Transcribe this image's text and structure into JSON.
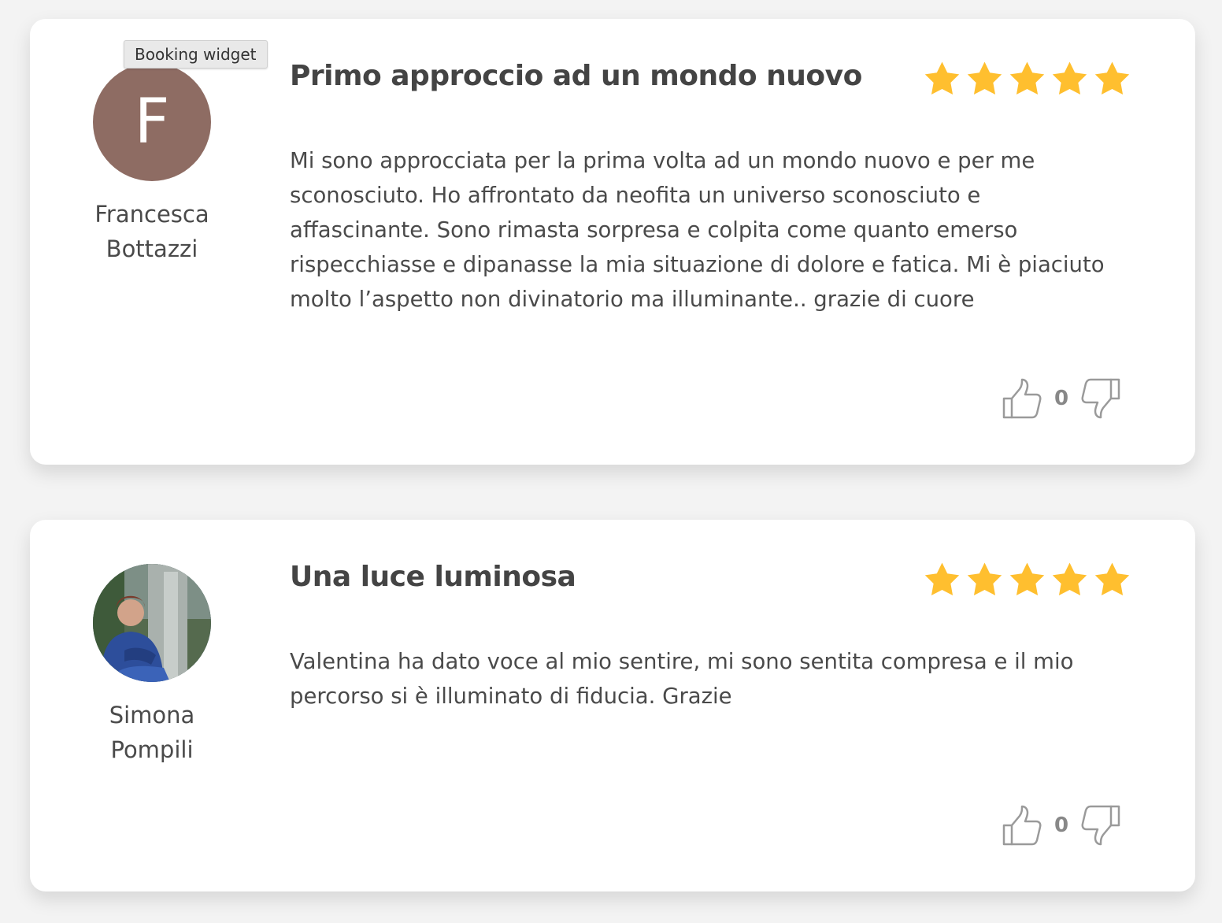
{
  "tooltip": {
    "text": "Booking widget"
  },
  "colors": {
    "star": "#ffbf2f",
    "avatar_bg": "#8e6c63",
    "vote_icon": "#9a9a9a"
  },
  "reviews": [
    {
      "author_initial": "F",
      "author_first": "Francesca",
      "author_last": "Bottazzi",
      "avatar_type": "letter",
      "title": "Primo approccio ad un mondo nuovo",
      "rating": 5,
      "body": "Mi sono approcciata per la prima volta ad un mondo nuovo e per me sconosciuto. Ho affrontato da neofita un universo sconosciuto e affascinante. Sono rimasta sorpresa e colpita come quanto emerso rispecchiasse e dipanasse la mia situazione di dolore e fatica. Mi è piaciuto molto l’aspetto non divinatorio ma illuminante.. grazie di cuore",
      "votes": "0",
      "icons": {
        "like": "thumbs-up-icon",
        "dislike": "thumbs-down-icon",
        "star": "star-icon"
      }
    },
    {
      "author_first": "Simona",
      "author_last": "Pompili",
      "avatar_type": "photo",
      "title": "Una luce luminosa",
      "rating": 5,
      "body": "Valentina ha dato voce al mio sentire, mi sono sentita compresa e il mio percorso si è illuminato di fiducia. Grazie",
      "votes": "0",
      "icons": {
        "like": "thumbs-up-icon",
        "dislike": "thumbs-down-icon",
        "star": "star-icon"
      }
    }
  ]
}
